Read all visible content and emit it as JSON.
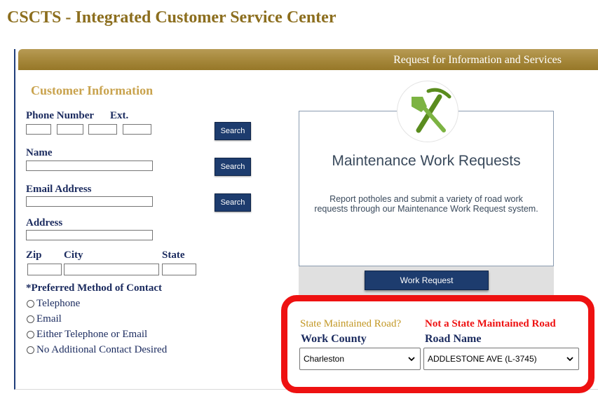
{
  "app": {
    "title": "CSCTS - Integrated Customer Service Center"
  },
  "banner": {
    "title": "Request for Information and Services"
  },
  "customer": {
    "section_title": "Customer Information",
    "phone_label": "Phone Number",
    "ext_label": "Ext.",
    "name_label": "Name",
    "email_label": "Email Address",
    "address_label": "Address",
    "zip_label": "Zip",
    "city_label": "City",
    "state_label": "State",
    "search_label": "Search",
    "contact_title": "*Preferred Method of Contact",
    "contact_options": [
      "Telephone",
      "Email",
      "Either Telephone or Email",
      "No Additional Contact Desired"
    ]
  },
  "card": {
    "title": "Maintenance Work Requests",
    "description": "Report potholes and submit a variety of road work requests through our Maintenance Work Request system.",
    "button_label": "Work Request",
    "icon": "shovel-pickaxe-icon"
  },
  "road": {
    "question": "State Maintained Road?",
    "status": "Not a State Maintained Road",
    "county_label": "Work County",
    "county_value": "Charleston",
    "road_label": "Road Name",
    "road_value": "ADDLESTONE AVE (L-3745)"
  },
  "colors": {
    "brand_gold": "#8c6e1e",
    "navy": "#1d3c6e",
    "highlight_red": "#ee1111"
  }
}
